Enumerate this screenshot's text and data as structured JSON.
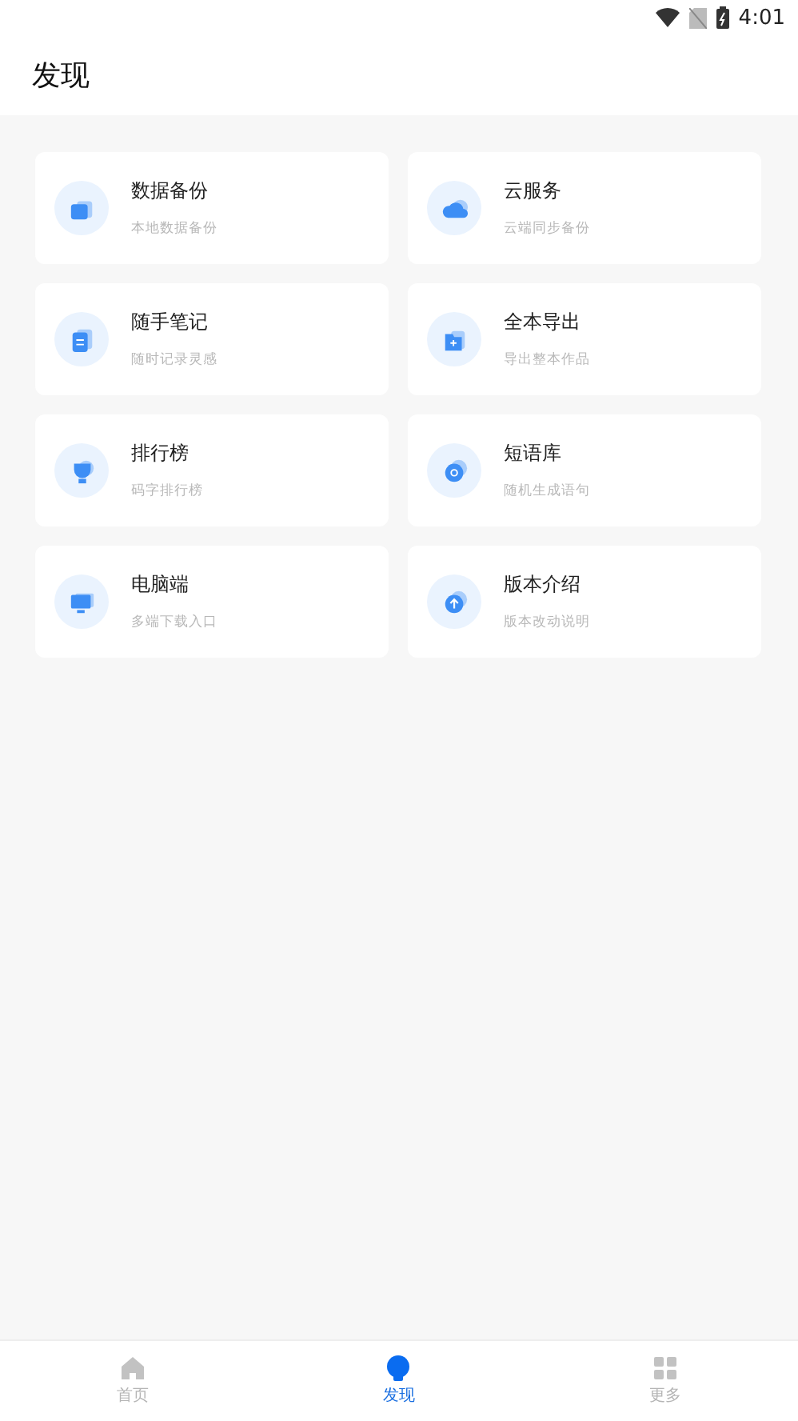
{
  "status_bar": {
    "time": "4:01"
  },
  "header": {
    "title": "发现"
  },
  "cards": [
    {
      "title": "数据备份",
      "subtitle": "本地数据备份"
    },
    {
      "title": "云服务",
      "subtitle": "云端同步备份"
    },
    {
      "title": "随手笔记",
      "subtitle": "随时记录灵感"
    },
    {
      "title": "全本导出",
      "subtitle": "导出整本作品"
    },
    {
      "title": "排行榜",
      "subtitle": "码字排行榜"
    },
    {
      "title": "短语库",
      "subtitle": "随机生成语句"
    },
    {
      "title": "电脑端",
      "subtitle": "多端下载入口"
    },
    {
      "title": "版本介绍",
      "subtitle": "版本改动说明"
    }
  ],
  "bottom_nav": [
    {
      "label": "首页",
      "selected": false
    },
    {
      "label": "发现",
      "selected": true
    },
    {
      "label": "更多",
      "selected": false
    }
  ]
}
